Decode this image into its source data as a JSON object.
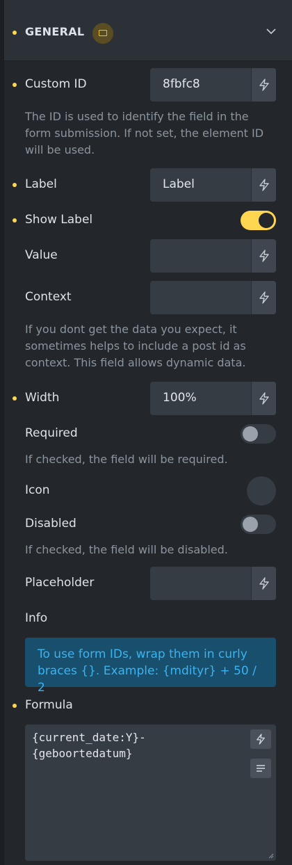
{
  "section": {
    "title": "GENERAL",
    "badge_icon": "screen-icon",
    "collapse_icon": "chevron-down-icon"
  },
  "fields": {
    "custom_id": {
      "label": "Custom ID",
      "value": "8fbfc8",
      "help": "The ID is used to identify the field in the form submission. If not set, the element ID will be used."
    },
    "label": {
      "label": "Label",
      "value": "Label"
    },
    "show_label": {
      "label": "Show Label",
      "enabled": true
    },
    "value": {
      "label": "Value",
      "value": ""
    },
    "context": {
      "label": "Context",
      "value": "",
      "help": "If you dont get the data you expect, it sometimes helps to include a post id as context. This field allows dynamic data."
    },
    "width": {
      "label": "Width",
      "value": "100%"
    },
    "required": {
      "label": "Required",
      "enabled": false,
      "help": "If checked, the field will be required."
    },
    "icon": {
      "label": "Icon"
    },
    "disabled": {
      "label": "Disabled",
      "enabled": false,
      "help": "If checked, the field will be disabled."
    },
    "placeholder": {
      "label": "Placeholder",
      "value": ""
    },
    "info": {
      "label": "Info",
      "text": "To use form IDs, wrap them in curly braces {}. Example: {mdityr} + 50 / 2"
    },
    "formula": {
      "label": "Formula",
      "value": "{current_date:Y}-\n{geboortedatum}"
    }
  },
  "colors": {
    "accent": "#ffd64f",
    "panel_bg": "#23272c",
    "input_bg": "#363c44",
    "info_bg": "#184f6c",
    "info_text": "#3ab3f2"
  }
}
